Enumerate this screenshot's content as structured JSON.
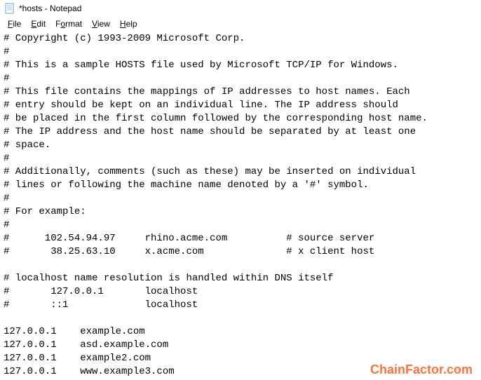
{
  "window": {
    "title": "*hosts - Notepad"
  },
  "menu": {
    "file": "File",
    "edit": "Edit",
    "format": "Format",
    "view": "View",
    "help": "Help"
  },
  "editor": {
    "content": "# Copyright (c) 1993-2009 Microsoft Corp.\n#\n# This is a sample HOSTS file used by Microsoft TCP/IP for Windows.\n#\n# This file contains the mappings of IP addresses to host names. Each\n# entry should be kept on an individual line. The IP address should\n# be placed in the first column followed by the corresponding host name.\n# The IP address and the host name should be separated by at least one\n# space.\n#\n# Additionally, comments (such as these) may be inserted on individual\n# lines or following the machine name denoted by a '#' symbol.\n#\n# For example:\n#\n#      102.54.94.97     rhino.acme.com          # source server\n#       38.25.63.10     x.acme.com              # x client host\n\n# localhost name resolution is handled within DNS itself\n#       127.0.0.1       localhost\n#       ::1             localhost\n\n127.0.0.1    example.com\n127.0.0.1    asd.example.com\n127.0.0.1    example2.com\n127.0.0.1    www.example3.com"
  },
  "watermark": {
    "text": "ChainFactor.com"
  }
}
